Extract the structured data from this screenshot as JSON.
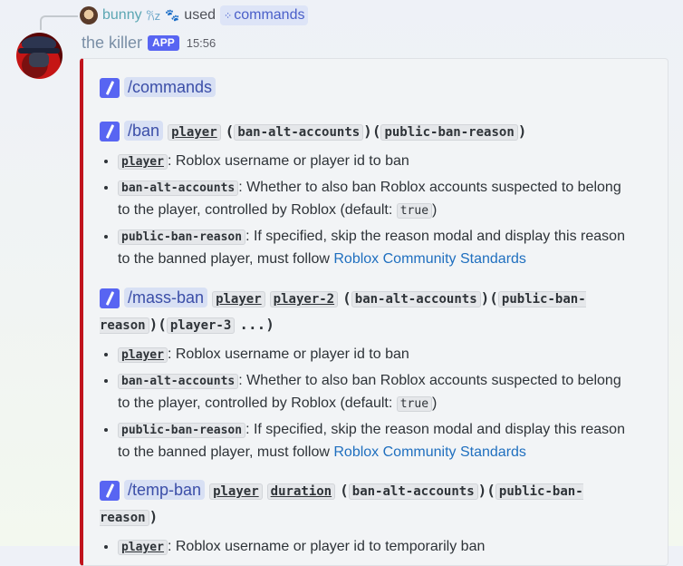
{
  "reply": {
    "username": "bunny",
    "deco": "𐙚z",
    "paw": "🐾",
    "used": "used",
    "command": "commands"
  },
  "author": {
    "name": "the killer",
    "badge": "APP",
    "time": "15:56"
  },
  "title": "/commands",
  "sections": [
    {
      "name": "/ban",
      "args": [
        "player",
        "(",
        "ban-alt-accounts",
        ")",
        "(",
        "public-ban-reason",
        ")"
      ],
      "items": [
        {
          "code": "player",
          "text": ": Roblox username or player id to ban"
        },
        {
          "code": "ban-alt-accounts",
          "text": ": Whether to also ban Roblox accounts suspected to belong to the player, controlled by Roblox (default: ",
          "value": "true",
          "after": ")"
        },
        {
          "code": "public-ban-reason",
          "text": ": If specified, skip the reason modal and display this reason to the banned player, must follow ",
          "link": "Roblox Community Standards"
        }
      ]
    },
    {
      "name": "/mass-ban",
      "args": [
        "player",
        "player-2",
        "(",
        "ban-alt-accounts",
        ")",
        "(",
        "public-ban-reason",
        ")",
        "(",
        "player-3",
        "...",
        ")"
      ],
      "items": [
        {
          "code": "player",
          "text": ": Roblox username or player id to ban"
        },
        {
          "code": "ban-alt-accounts",
          "text": ": Whether to also ban Roblox accounts suspected to belong to the player, controlled by Roblox (default: ",
          "value": "true",
          "after": ")"
        },
        {
          "code": "public-ban-reason",
          "text": ": If specified, skip the reason modal and display this reason to the banned player, must follow ",
          "link": "Roblox Community Standards"
        }
      ]
    },
    {
      "name": "/temp-ban",
      "args": [
        "player",
        "duration",
        "(",
        "ban-alt-accounts",
        ")",
        "(",
        "public-ban-reason",
        ")"
      ],
      "items": [
        {
          "code": "player",
          "text": ": Roblox username or player id to temporarily ban"
        }
      ]
    }
  ]
}
